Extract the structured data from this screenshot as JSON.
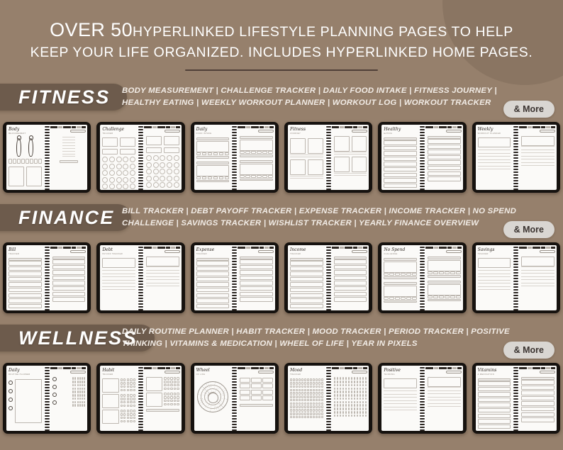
{
  "theme": {
    "background": "#96806c",
    "blob": "#8a7562",
    "pill_bg": "#6d5b4c",
    "text_light": "#ffffff",
    "badge_bg": "#d9d6d2",
    "badge_text": "#3a3330",
    "rule": "#4f4038",
    "device_frame": "#16120f",
    "screen": "#fbfaf8"
  },
  "header": {
    "big": "OVER 50",
    "line1_rest": "HYPERLINKED LIFESTYLE PLANNING PAGES TO HELP",
    "line2": "KEEP YOUR LIFE ORGANIZED. INCLUDES HYPERLINKED HOME PAGES."
  },
  "sections": [
    {
      "id": "fitness",
      "label": "FITNESS",
      "desc_line1": "BODY MEASUREMENT |  CHALLENGE TRACKER |  DAILY FOOD INTAKE |  FITNESS JOURNEY |",
      "desc_line2": "HEALTHY EATING |  WEEKLY WORKOUT PLANNER |  WORKOUT LOG |  WORKOUT TRACKER",
      "more_label": "& More",
      "tablets": [
        {
          "title": "Body",
          "subtitle": "MEASUREMENT",
          "layout": "measurement"
        },
        {
          "title": "Challenge",
          "subtitle": "TRACKER",
          "layout": "circles"
        },
        {
          "title": "Daily",
          "subtitle": "FOOD INTAKE",
          "layout": "quadbox"
        },
        {
          "title": "Fitness",
          "subtitle": "JOURNEY",
          "layout": "photogrid"
        },
        {
          "title": "Healthy",
          "subtitle": "EATING",
          "layout": "table"
        },
        {
          "title": "Weekly",
          "subtitle": "WORKOUT PLANNER",
          "layout": "blocks"
        }
      ]
    },
    {
      "id": "finance",
      "label": "FINANCE",
      "desc_line1": "BILL TRACKER |  DEBT PAYOFF TRACKER |  EXPENSE TRACKER |  INCOME TRACKER |  NO SPEND",
      "desc_line2": "CHALLENGE |  SAVINGS TRACKER |  WISHLIST TRACKER |  YEARLY FINANCE OVERVIEW",
      "more_label": "& More",
      "tablets": [
        {
          "title": "Bill",
          "subtitle": "TRACKER",
          "layout": "table"
        },
        {
          "title": "Debt",
          "subtitle": "PAYOFF TRACKER",
          "layout": "blocks"
        },
        {
          "title": "Expense",
          "subtitle": "TRACKER",
          "layout": "table"
        },
        {
          "title": "Income",
          "subtitle": "TRACKER",
          "layout": "table"
        },
        {
          "title": "No Spend",
          "subtitle": "CHALLENGE",
          "layout": "quadbox"
        },
        {
          "title": "Savings",
          "subtitle": "TRACKER",
          "layout": "blocks"
        }
      ]
    },
    {
      "id": "wellness",
      "label": "WELLNESS",
      "desc_line1": "DAILY ROUTINE PLANNER |  HABIT TRACKER |  MOOD TRACKER |  PERIOD TRACKER |  POSITIVE",
      "desc_line2": "THINKING | VITAMINS & MEDICATION |  WHEEL OF LIFE |  YEAR IN PIXELS",
      "more_label": "& More",
      "tablets": [
        {
          "title": "Daily",
          "subtitle": "ROUTINE PLANNER",
          "layout": "routine"
        },
        {
          "title": "Habit",
          "subtitle": "TRACKER",
          "layout": "habit"
        },
        {
          "title": "Wheel",
          "subtitle": "OF LIFE",
          "layout": "wheel"
        },
        {
          "title": "Mood",
          "subtitle": "TRACKER",
          "layout": "pixels"
        },
        {
          "title": "Positive",
          "subtitle": "THINKING",
          "layout": "blocks"
        },
        {
          "title": "Vitamins",
          "subtitle": "& MEDICATION",
          "layout": "table"
        }
      ]
    }
  ]
}
